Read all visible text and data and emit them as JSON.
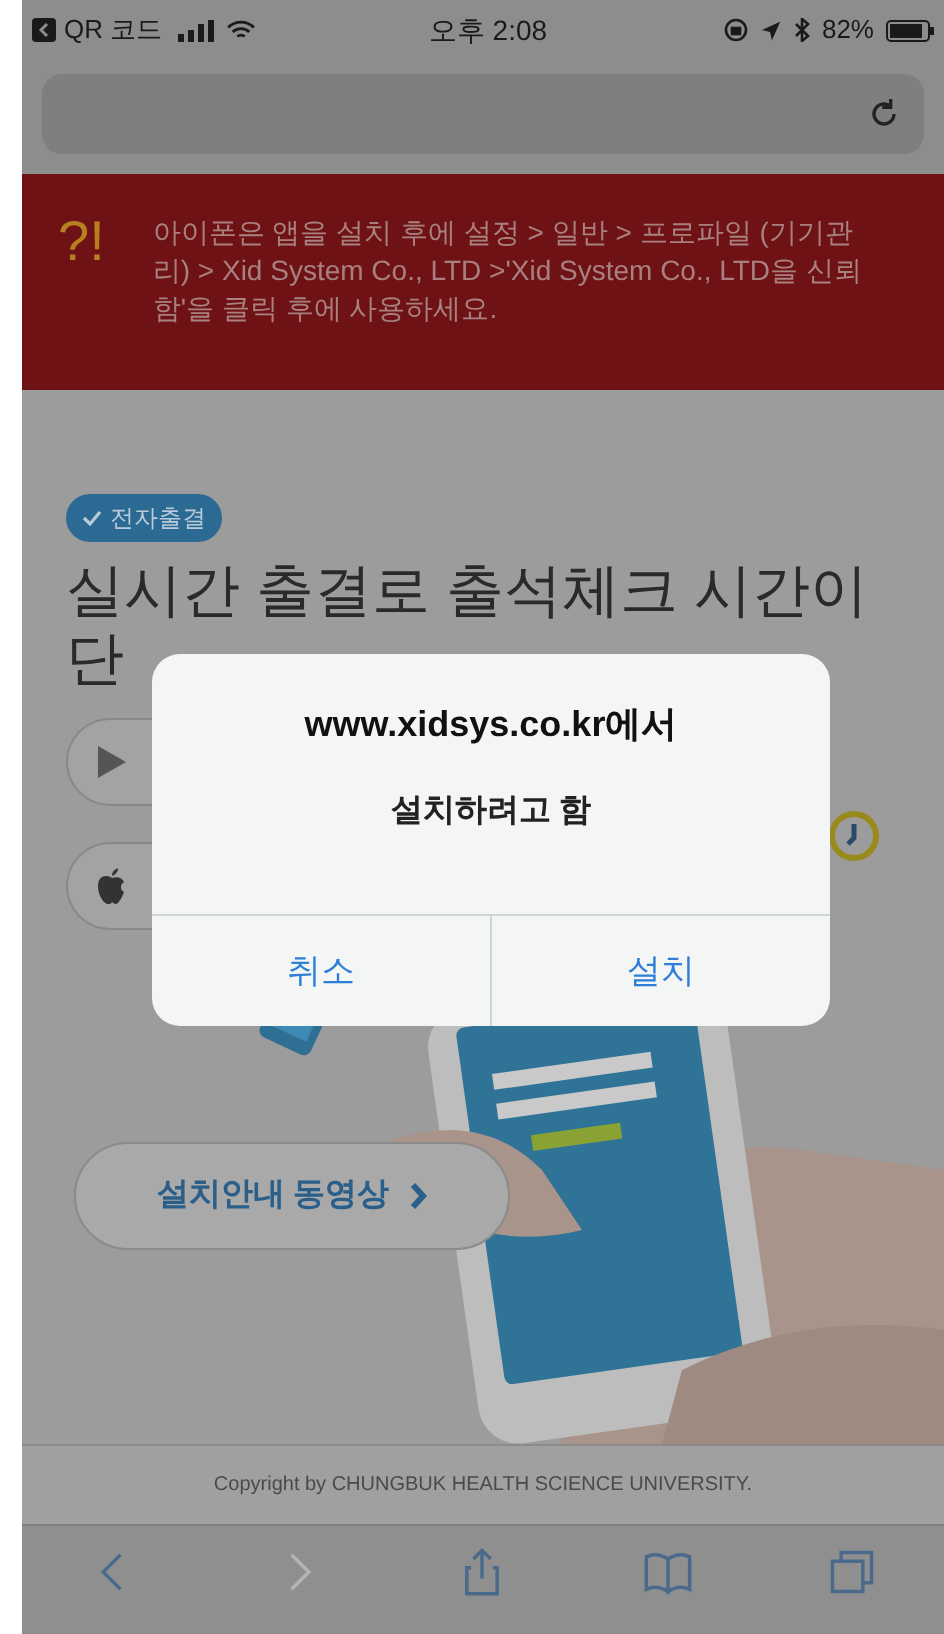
{
  "status_bar": {
    "back_app": "QR 코드",
    "time": "오후 2:08",
    "battery": "82%"
  },
  "banner": {
    "mark": "?!",
    "message": "아이폰은 앱을 설치 후에 설정 > 일반 > 프로파일 (기기관리) > Xid System Co., LTD >'Xid System Co., LTD을 신뢰함'을 클릭 후에 사용하세요."
  },
  "hero": {
    "badge": "전자출결",
    "headline_1": "실시간 출결로 출석체크 시간이",
    "headline_2": "단",
    "video_button": "설치안내 동영상"
  },
  "footer": "Copyright by CHUNGBUK HEALTH SCIENCE UNIVERSITY.",
  "toolbar": [
    {
      "kind": "back",
      "disabled": false
    },
    {
      "kind": "forward",
      "disabled": true
    },
    {
      "kind": "share",
      "disabled": false
    },
    {
      "kind": "bookmarks",
      "disabled": false
    },
    {
      "kind": "tabs",
      "disabled": false
    }
  ],
  "dialog": {
    "title": "www.xidsys.co.kr에서",
    "message": "설치하려고 함",
    "buttons": [
      "취소",
      "설치"
    ]
  }
}
